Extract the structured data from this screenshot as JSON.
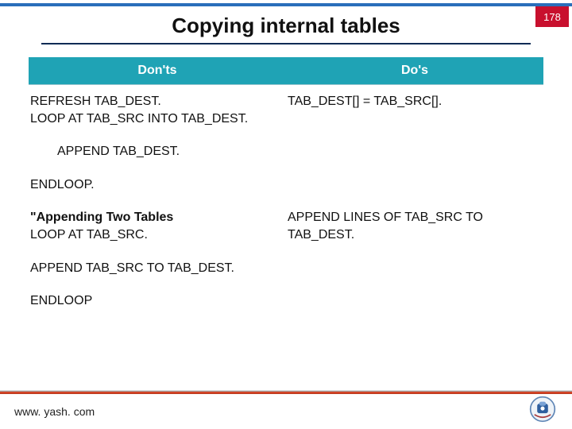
{
  "page": {
    "title": "Copying internal tables",
    "number": "178"
  },
  "table": {
    "headers": {
      "left": "Don'ts",
      "right": "Do's"
    },
    "rows": [
      {
        "left": "REFRESH TAB_DEST.\nLOOP AT TAB_SRC INTO TAB_DEST.",
        "right": "TAB_DEST[] = TAB_SRC[]."
      },
      {
        "left_indent": "APPEND TAB_DEST.",
        "right": ""
      },
      {
        "left": "ENDLOOP.",
        "right": ""
      },
      {
        "left_bold": "\"Appending Two Tables",
        "left": "LOOP AT TAB_SRC.",
        "right": "APPEND LINES OF TAB_SRC TO TAB_DEST."
      },
      {
        "left": "APPEND TAB_SRC TO TAB_DEST.",
        "right": ""
      },
      {
        "left": "ENDLOOP",
        "right": ""
      }
    ]
  },
  "footer": {
    "url": "www. yash. com"
  }
}
